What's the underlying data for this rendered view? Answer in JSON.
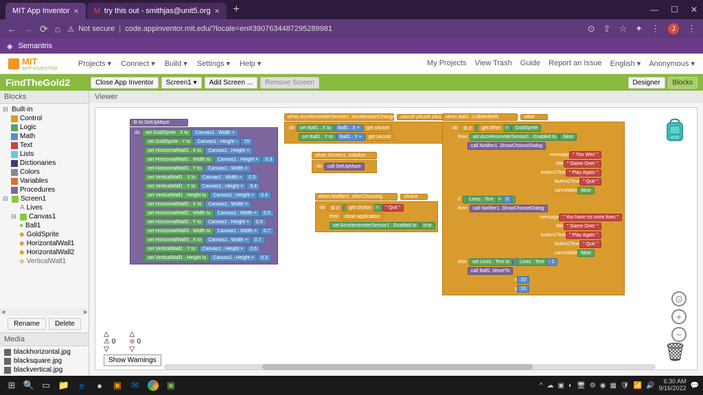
{
  "browser": {
    "tabs": [
      {
        "title": "MIT App Inventor",
        "active": true
      },
      {
        "title": "try this out - smithjas@unit5.org",
        "active": false
      }
    ],
    "url": "code.appinventor.mit.edu/?locale=en#3907634487295289981",
    "security_text": "Not secure",
    "user_letter": "J",
    "bookmark": "Semantris"
  },
  "app": {
    "logo_text": "MIT",
    "logo_sub": "APP INVENTOR",
    "menu": [
      "Projects",
      "Connect",
      "Build",
      "Settings",
      "Help"
    ],
    "right_menu": [
      "My Projects",
      "View Trash",
      "Guide",
      "Report an Issue",
      "English",
      "Anonymous"
    ]
  },
  "green_bar": {
    "project": "FindTheGold2",
    "buttons": [
      "Close App Inventor",
      "Screen1",
      "Add Screen ...",
      "Remove Screen"
    ],
    "right": [
      "Designer",
      "Blocks"
    ]
  },
  "sidebar": {
    "blocks_header": "Blocks",
    "builtin": "Built-in",
    "categories": [
      {
        "name": "Control",
        "color": "#d99b2e"
      },
      {
        "name": "Logic",
        "color": "#5ba55b"
      },
      {
        "name": "Math",
        "color": "#5b8fc7"
      },
      {
        "name": "Text",
        "color": "#c74545"
      },
      {
        "name": "Lists",
        "color": "#6ac6e6"
      },
      {
        "name": "Dictionaries",
        "color": "#3d3d6b"
      },
      {
        "name": "Colors",
        "color": "#888"
      },
      {
        "name": "Variables",
        "color": "#d9702e"
      },
      {
        "name": "Procedures",
        "color": "#7d669e"
      }
    ],
    "components": [
      "Screen1",
      "Lives",
      "Canvas1",
      "Ball1",
      "GoldSprite",
      "HorizontalWall1",
      "HorizontalWall2",
      "VerticalWall1"
    ],
    "rename": "Rename",
    "delete": "Delete",
    "media_header": "Media",
    "media": [
      "blackhorizontal.jpg",
      "blacksquare.jpg",
      "blackvertical.jpg"
    ]
  },
  "viewer": {
    "header": "Viewer",
    "show_warnings": "Show Warnings",
    "warn_count": "0",
    "err_count": "0"
  },
  "blocks": {
    "setup": "to SetUpMaze",
    "accel": "when AccelerometerSensor1 .AccelerationChanged",
    "accel_params": "xAccel   yAccel   zAccel",
    "init": "when Screen1 .Initialize",
    "notifier": "when Notifier1 .AfterChoosing",
    "choice": "choice",
    "collided": "when Ball1 .CollidedWith",
    "other": "other",
    "you_win": "You Win!",
    "game_over": "Game Over",
    "play_again": "Play Again",
    "quit": "Quit",
    "no_lives": "You have no more lives",
    "close_app": "close application",
    "moveto": "call Ball1 .MoveTo",
    "show_dialog": ".ShowChooseDialog",
    "message": "message",
    "title": "title",
    "b1text": "button1Text",
    "b2text": "button2Text",
    "cancelable": "cancelable",
    "false": "false",
    "true": "true",
    "enabled": "Enabled",
    "lives": "Lives",
    "text": "Text",
    "ball_x": "set Ball1 . X to",
    "ball_y": "set Ball1 . Y to",
    "canvas_w": "Canvas1 . Width",
    "canvas_h": "Canvas1 . Height",
    "n70": "70",
    "n03": "0.3",
    "n04": "0.4",
    "n05": "0.5",
    "n06": "0.6",
    "n07": "0.7",
    "n10": "10",
    "n0": "0",
    "goldsprite": "GoldSprite",
    "get_other": "get other",
    "get_choice": "get choice",
    "get_xaccel": "get xAccel",
    "get_yaccel": "get yAccel"
  },
  "taskbar": {
    "time": "6:30 AM",
    "date": "9/16/2022"
  }
}
